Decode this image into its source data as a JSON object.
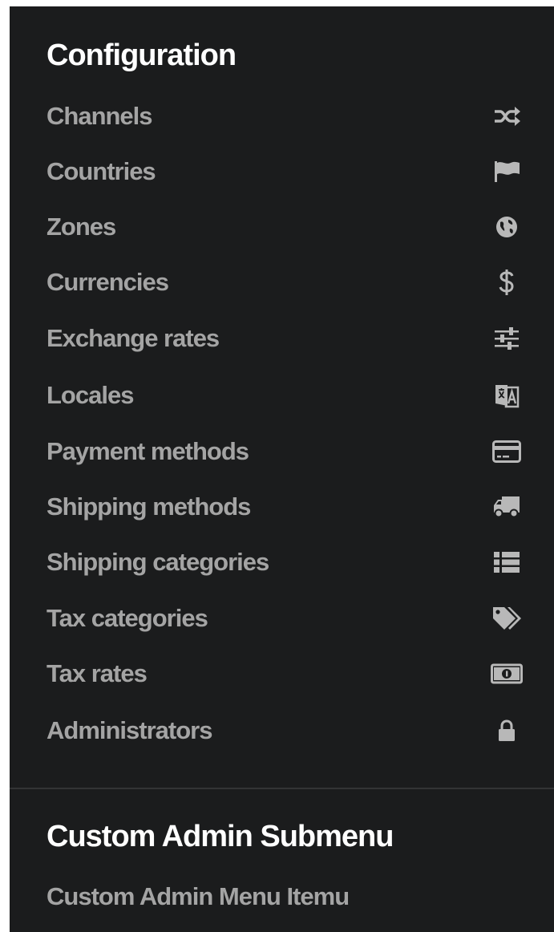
{
  "configuration": {
    "title": "Configuration",
    "items": [
      {
        "label": "Channels",
        "icon": "shuffle-icon"
      },
      {
        "label": "Countries",
        "icon": "flag-icon"
      },
      {
        "label": "Zones",
        "icon": "globe-icon"
      },
      {
        "label": "Currencies",
        "icon": "dollar-icon"
      },
      {
        "label": "Exchange rates",
        "icon": "sliders-icon"
      },
      {
        "label": "Locales",
        "icon": "translate-icon"
      },
      {
        "label": "Payment methods",
        "icon": "credit-card-icon"
      },
      {
        "label": "Shipping methods",
        "icon": "truck-icon"
      },
      {
        "label": "Shipping categories",
        "icon": "list-icon"
      },
      {
        "label": "Tax categories",
        "icon": "tags-icon"
      },
      {
        "label": "Tax rates",
        "icon": "money-icon"
      },
      {
        "label": "Administrators",
        "icon": "lock-icon"
      }
    ]
  },
  "custom": {
    "title": "Custom Admin Submenu",
    "items": [
      {
        "label": "Custom Admin Menu Itemu"
      }
    ]
  },
  "colors": {
    "background": "#1b1c1d",
    "title": "#ffffff",
    "item_text": "#a4a4a4",
    "icon": "#b8b8b8",
    "divider": "#333435"
  }
}
